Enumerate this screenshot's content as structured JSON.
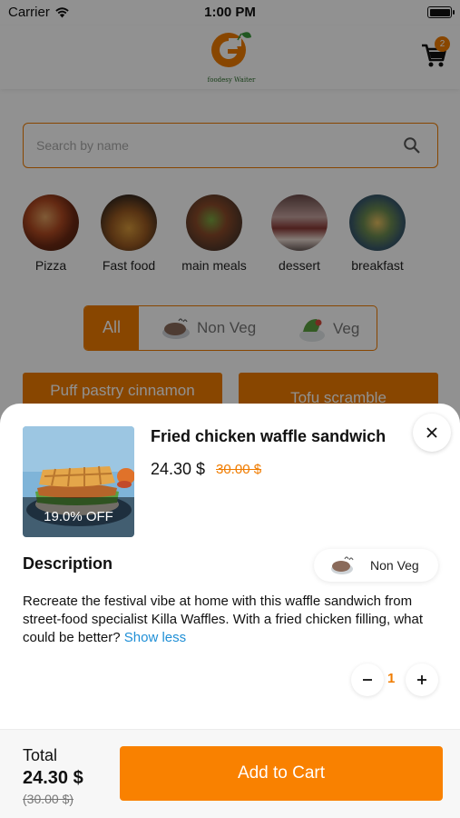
{
  "status_bar": {
    "carrier": "Carrier",
    "time": "1:00 PM"
  },
  "header": {
    "logo_text": "foodesy Waiter",
    "cart_count": "2"
  },
  "search": {
    "placeholder": "Search by name"
  },
  "categories": [
    {
      "label": "Pizza"
    },
    {
      "label": "Fast food"
    },
    {
      "label": "main meals"
    },
    {
      "label": "dessert"
    },
    {
      "label": "breakfast"
    }
  ],
  "filters": {
    "all": "All",
    "non_veg": "Non Veg",
    "veg": "Veg"
  },
  "products_behind": [
    "Puff pastry cinnamon",
    "Tofu scramble"
  ],
  "sheet": {
    "name": "Fried chicken waffle sandwich",
    "price": "24.30 $",
    "old_price": "30.00 $",
    "discount": "19.0% OFF",
    "description_title": "Description",
    "diet": "Non Veg",
    "description": "Recreate the festival vibe at home with this waffle sandwich from street-food specialist Killa Waffles. With a fried chicken filling, what could be better?",
    "show_less": "Show less",
    "quantity": "1"
  },
  "footer": {
    "total_label": "Total",
    "total": "24.30 $",
    "total_old": "(30.00 $)",
    "add_button": "Add to Cart"
  },
  "colors": {
    "accent": "#f07c00",
    "link": "#1f8fd6"
  }
}
